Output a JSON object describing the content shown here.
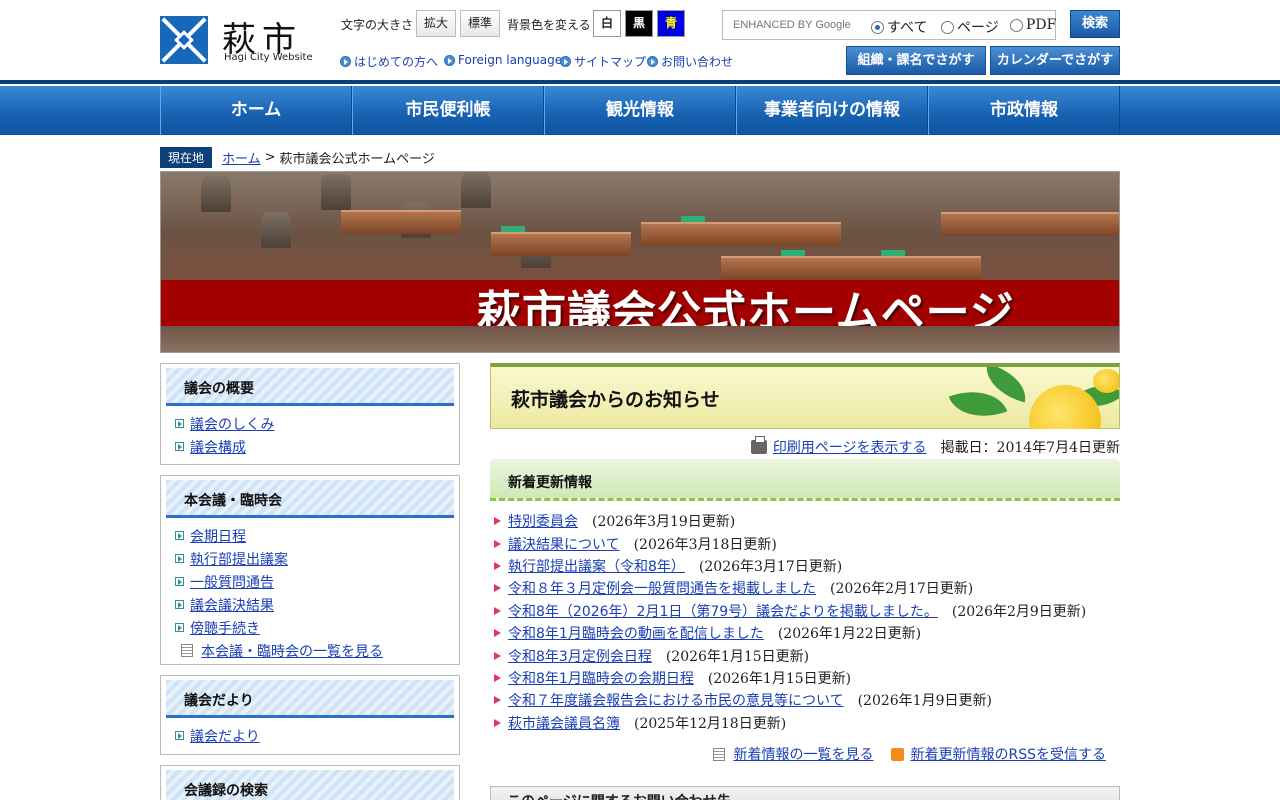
{
  "header": {
    "logo_text": "萩市",
    "logo_sub": "Hagi City Website",
    "font_size_label": "文字の大きさ",
    "font_enlarge": "拡大",
    "font_standard": "標準",
    "bg_color_label": "背景色を変える",
    "bg_white": "白",
    "bg_black": "黒",
    "bg_blue": "青",
    "search_placeholder": "ENHANCED BY Google",
    "radio_all": "すべて",
    "radio_page": "ページ",
    "radio_pdf": "PDF",
    "search_button": "検索",
    "links": [
      "はじめての方へ",
      "Foreign language",
      "サイトマップ",
      "お問い合わせ"
    ],
    "org_button": "組織・課名でさがす",
    "calendar_button": "カレンダーでさがす"
  },
  "nav": [
    "ホーム",
    "市民便利帳",
    "観光情報",
    "事業者向けの情報",
    "市政情報"
  ],
  "breadcrumb": {
    "badge": "現在地",
    "home": "ホーム",
    "separator": ">",
    "current": "萩市議会公式ホームページ"
  },
  "banner": {
    "title": "萩市議会公式ホームページ"
  },
  "sidebar": [
    {
      "title": "議会の概要",
      "items": [
        "議会のしくみ",
        "議会構成"
      ]
    },
    {
      "title": "本会議・臨時会",
      "items": [
        "会期日程",
        "執行部提出議案",
        "一般質問通告",
        "議会議決結果",
        "傍聴手続き"
      ],
      "more": "本会議・臨時会の一覧を見る"
    },
    {
      "title": "議会だより",
      "items": [
        "議会だより"
      ]
    },
    {
      "title": "会議録の検索",
      "items": []
    }
  ],
  "notice": {
    "title": "萩市議会からのお知らせ"
  },
  "print": {
    "label": "印刷用ページを表示する",
    "date": "掲載日：2014年7月4日更新"
  },
  "news": {
    "title": "新着更新情報",
    "items": [
      {
        "label": "特別委員会",
        "date": "(2026年3月19日更新)"
      },
      {
        "label": "議決結果について",
        "date": "(2026年3月18日更新)"
      },
      {
        "label": "執行部提出議案（令和8年）",
        "date": "(2026年3月17日更新)"
      },
      {
        "label": "令和８年３月定例会一般質問通告を掲載しました",
        "date": "(2026年2月17日更新)"
      },
      {
        "label": "令和8年（2026年）2月1日（第79号）議会だよりを掲載しました。",
        "date": "(2026年2月9日更新)"
      },
      {
        "label": "令和8年1月臨時会の動画を配信しました",
        "date": "(2026年1月22日更新)"
      },
      {
        "label": "令和8年3月定例会日程",
        "date": "(2026年1月15日更新)"
      },
      {
        "label": "令和8年1月臨時会の会期日程",
        "date": "(2026年1月15日更新)"
      },
      {
        "label": "令和７年度議会報告会における市民の意見等について",
        "date": "(2026年1月9日更新)"
      },
      {
        "label": "萩市議会議員名簿",
        "date": "(2025年12月18日更新)"
      }
    ],
    "more": "新着情報の一覧を見る",
    "rss": "新着更新情報のRSSを受信する"
  },
  "contact": {
    "title": "このページに関するお問い合わせ先"
  },
  "colors": {
    "brand_blue": "#1867b8",
    "nav_blue": "#1660b0",
    "banner_red": "#a30000",
    "link": "#1a3fb4"
  }
}
